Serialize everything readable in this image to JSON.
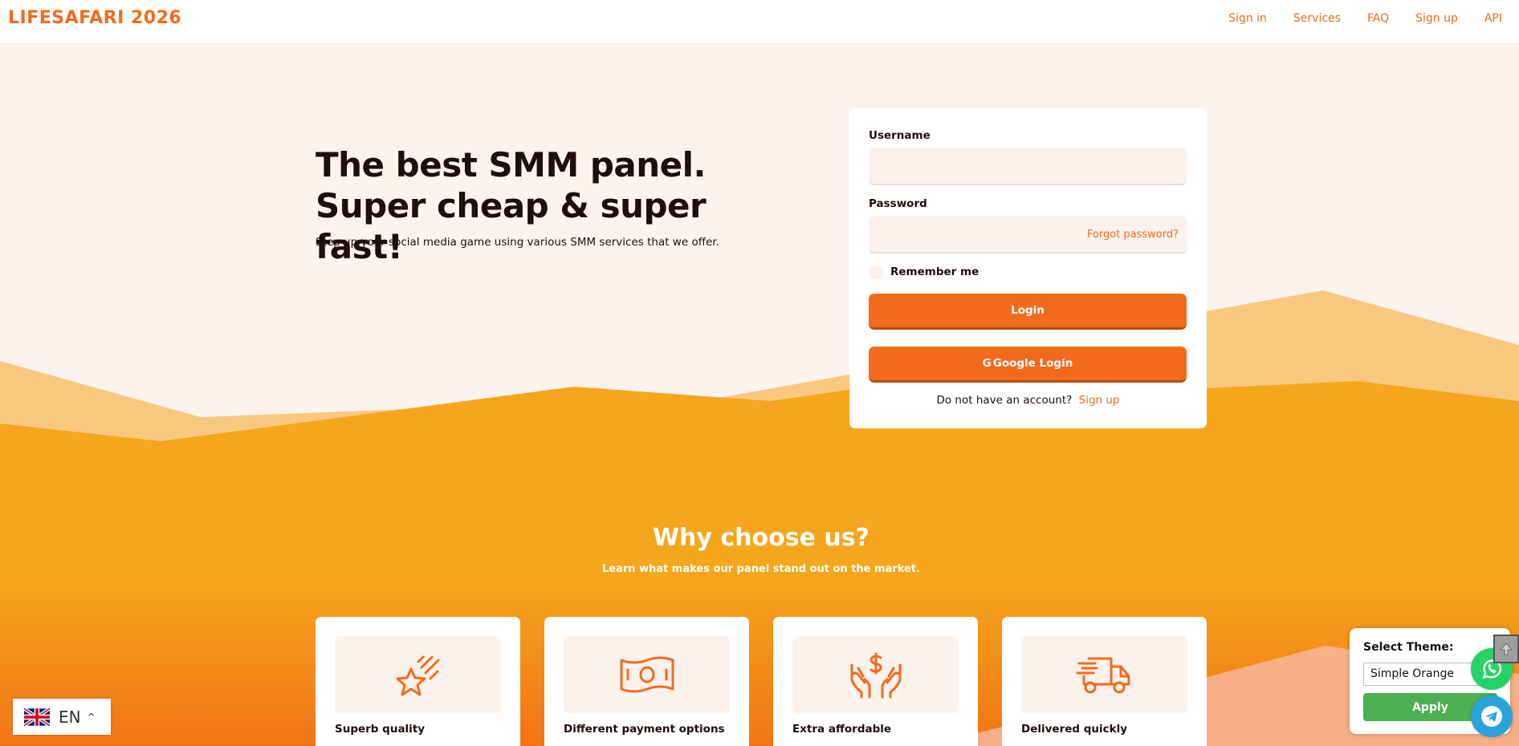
{
  "nav": {
    "brand": "LIFESAFARI 2026",
    "links": [
      "Sign in",
      "Services",
      "FAQ",
      "Sign up",
      "API"
    ]
  },
  "hero": {
    "title": "The best SMM panel. Super cheap & super fast!",
    "subtitle": "Step up your social media game using various SMM services that we offer."
  },
  "login": {
    "username_label": "Username",
    "username_value": "",
    "password_label": "Password",
    "password_value": "",
    "forgot_password": "Forgot password?",
    "remember_me": "Remember me",
    "login_button": "Login",
    "google_icon": "G",
    "google_button": "Google Login",
    "no_account_text": "Do not have an account?",
    "signup_link": "Sign up"
  },
  "why": {
    "title": "Why choose us?",
    "subtitle": "Learn what makes our panel stand out on the market.",
    "features": [
      {
        "label": "Superb quality",
        "icon": "shooting-star-icon"
      },
      {
        "label": "Different payment options",
        "icon": "banknote-icon"
      },
      {
        "label": "Extra affordable",
        "icon": "hands-dollar-icon"
      },
      {
        "label": "Delivered quickly",
        "icon": "delivery-truck-icon"
      }
    ]
  },
  "language": {
    "code": "EN",
    "flag_icon": "uk-flag-icon",
    "caret": "^"
  },
  "theme": {
    "label": "Select Theme:",
    "selected": "Simple Orange",
    "apply": "Apply"
  },
  "floating": {
    "whatsapp_icon": "whatsapp-icon",
    "telegram_icon": "telegram-icon",
    "scroll_icon": "scroll-top-icon"
  },
  "colors": {
    "accent": "#f26b1d",
    "wave_light": "#f9c87f",
    "wave_main": "#f5a31a",
    "apply_green": "#4caf50"
  }
}
